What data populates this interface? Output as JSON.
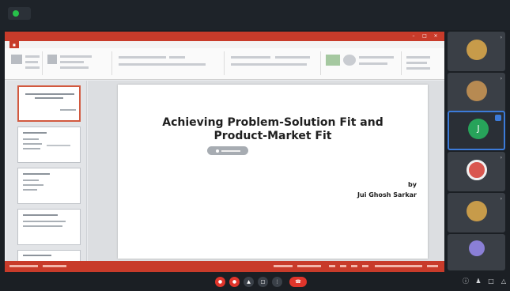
{
  "meeting": {
    "share_icon": "screen-share-icon",
    "share_color": "#27c04a"
  },
  "slide": {
    "title_line1": "Achieving Problem-Solution Fit and",
    "title_line2": "Product-Market Fit",
    "by": "by",
    "author": "Jui Ghosh Sarkar"
  },
  "app": {
    "accent": "#c83b2a",
    "ribbon_tab_file_icon": "file-tab-icon"
  },
  "participants": [
    {
      "avatar": "photo",
      "color": "#c79b4a"
    },
    {
      "avatar": "photo",
      "color": "#b78a52"
    },
    {
      "avatar": "letter",
      "letter": "J",
      "color": "#27a35a",
      "speaking": true
    },
    {
      "avatar": "photo",
      "color": "#d9574f"
    },
    {
      "avatar": "photo",
      "color": "#c79b4a"
    },
    {
      "avatar": "photo",
      "color": "#8a7fd6"
    }
  ],
  "controls": {
    "items": [
      "mic-icon",
      "camera-icon",
      "share-icon",
      "chat-icon",
      "more-icon",
      "end-call-icon"
    ],
    "right": [
      "info-icon",
      "people-icon",
      "chat-icon",
      "activities-icon"
    ]
  }
}
